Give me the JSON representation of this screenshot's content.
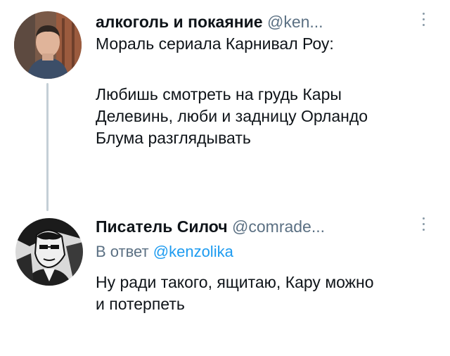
{
  "tweets": [
    {
      "author": {
        "display_name": "алкоголь и покаяние",
        "handle": "@ken..."
      },
      "text_lines": [
        "Мораль сериала Карнивал Роу:",
        "",
        "Любишь смотреть на грудь Кары",
        "Делевинь, люби и задницу Орландо",
        "Блума разглядывать"
      ]
    },
    {
      "author": {
        "display_name": "Писатель Силоч",
        "handle": "@comrade..."
      },
      "reply_to": {
        "prefix": "В ответ",
        "mention": "@kenzolika"
      },
      "text_lines": [
        "Ну ради такого, ящитаю, Кару можно",
        "и потерпеть"
      ]
    }
  ],
  "icons": {
    "more": "more-vertical-icon"
  },
  "colors": {
    "text": "#0f1419",
    "secondary": "#5b7083",
    "link": "#1d9bf0",
    "thread_line": "#c4cfd6"
  }
}
